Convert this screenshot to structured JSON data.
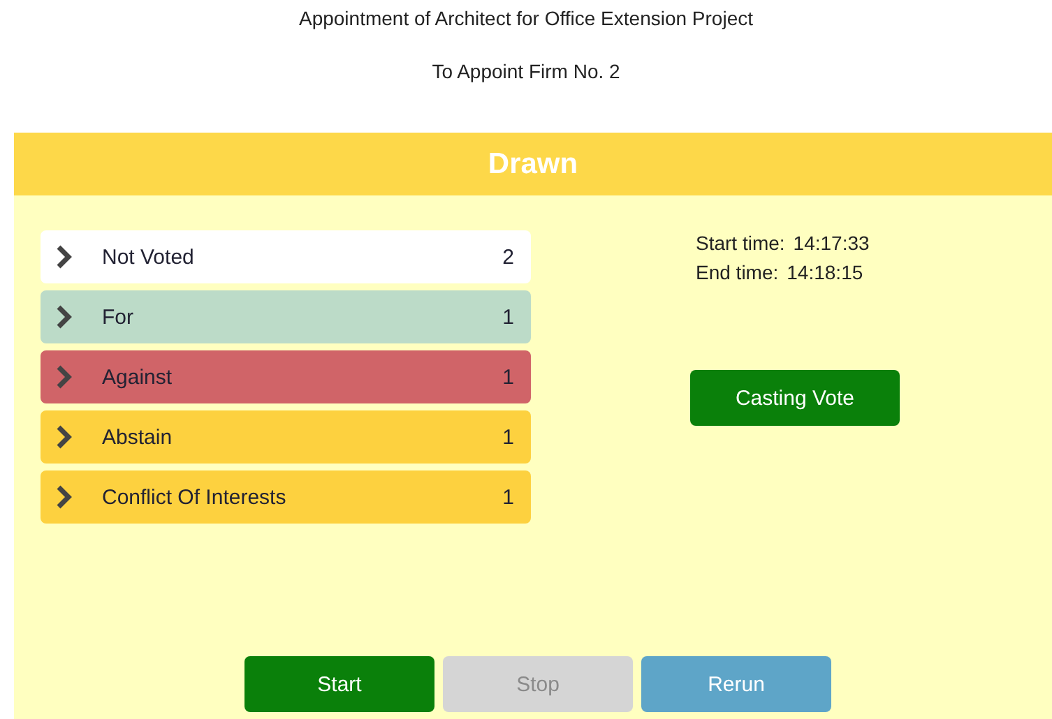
{
  "subtitle": "Appointment of Architect for Office Extension Project",
  "motion": "To Appoint Firm No. 2",
  "result": "Drawn",
  "tallies": [
    {
      "label": "Not Voted",
      "count": "2",
      "color": "#ffffff"
    },
    {
      "label": "For",
      "count": "1",
      "color": "#bcdbc8"
    },
    {
      "label": "Against",
      "count": "1",
      "color": "#d06468"
    },
    {
      "label": "Abstain",
      "count": "1",
      "color": "#fdd13f"
    },
    {
      "label": "Conflict Of Interests",
      "count": "1",
      "color": "#fdd13f"
    }
  ],
  "times": [
    {
      "label": "Start time:",
      "value": "14:17:33"
    },
    {
      "label": "End time:",
      "value": "14:18:15"
    }
  ],
  "casting_vote": {
    "label": "Casting Vote",
    "disabled": false
  },
  "buttons": [
    {
      "label": "Start",
      "kind": "start",
      "disabled": false
    },
    {
      "label": "Stop",
      "kind": "stop",
      "disabled": true
    },
    {
      "label": "Rerun",
      "kind": "rerun",
      "disabled": false
    }
  ]
}
